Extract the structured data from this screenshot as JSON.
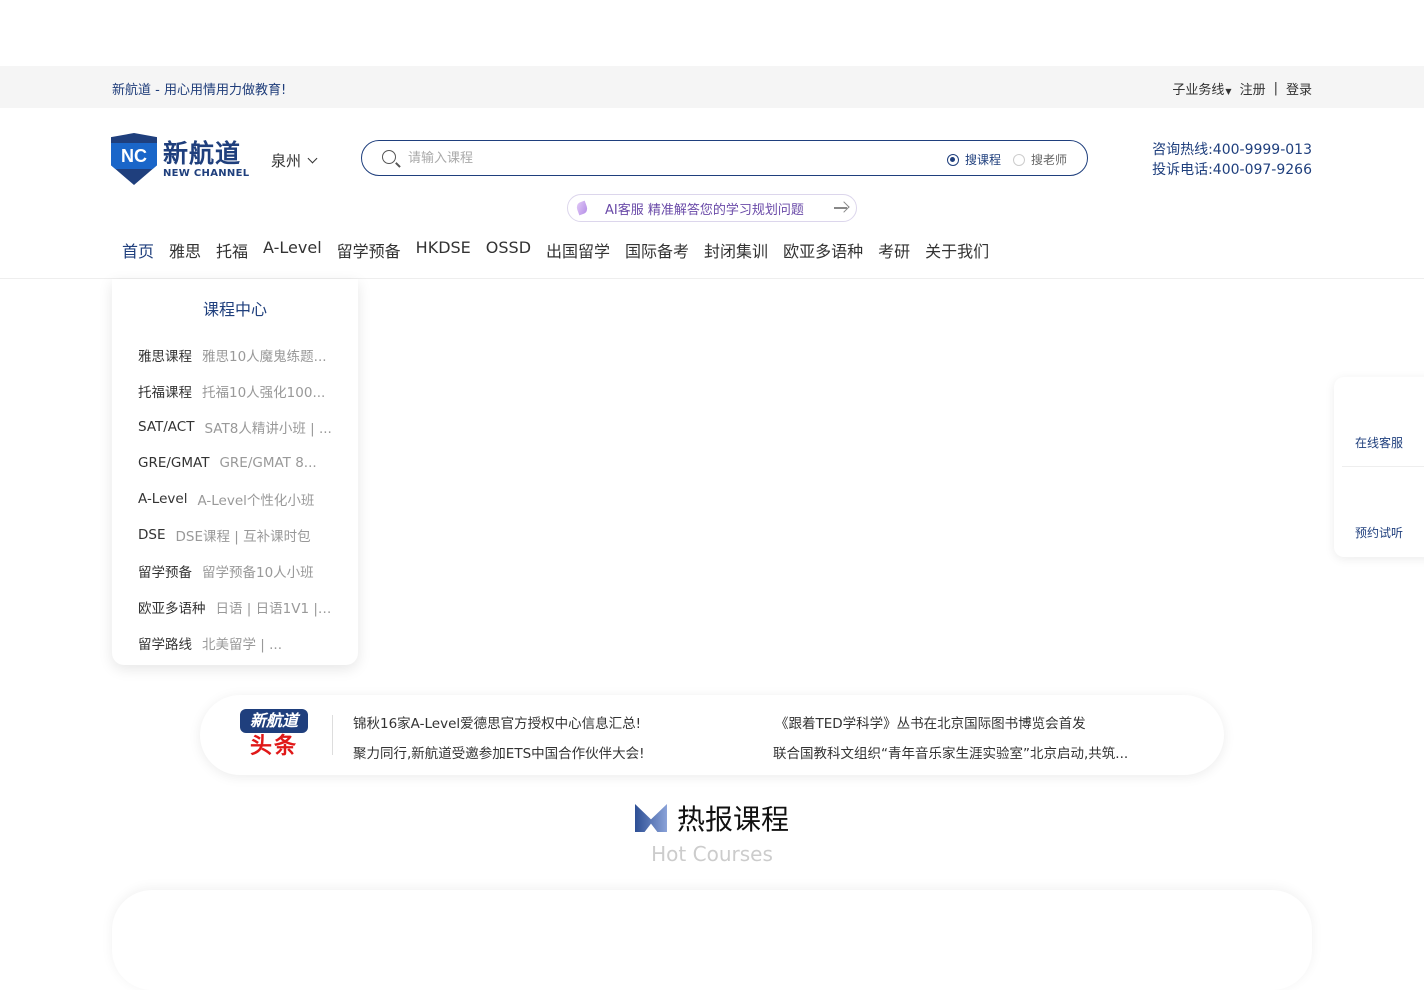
{
  "topbar": {
    "slogan": "新航道 - 用心用情用力做教育!",
    "business_line": "子业务线",
    "register": "注册",
    "separator": "|",
    "login": "登录"
  },
  "logo": {
    "mark": "NC",
    "cn": "新航道",
    "en": "NEW CHANNEL"
  },
  "city": {
    "name": "泉州"
  },
  "search": {
    "placeholder": "请输入课程",
    "options": [
      {
        "label": "搜课程",
        "selected": true
      },
      {
        "label": "搜老师",
        "selected": false
      }
    ]
  },
  "hotline": {
    "consult": "咨询热线:400-9999-013",
    "complaint": "投诉电话:400-097-9266"
  },
  "ai_banner": {
    "text": "AI客服 精准解答您的学习规划问题"
  },
  "nav": {
    "items": [
      "首页",
      "雅思",
      "托福",
      "A-Level",
      "留学预备",
      "HKDSE",
      "OSSD",
      "出国留学",
      "国际备考",
      "封闭集训",
      "欧亚多语种",
      "考研",
      "关于我们"
    ],
    "active_index": 0
  },
  "course_menu": {
    "title": "课程中心",
    "items": [
      {
        "name": "雅思课程",
        "desc": "雅思10人魔鬼练题..."
      },
      {
        "name": "托福课程",
        "desc": "托福10人强化100..."
      },
      {
        "name": "SAT/ACT",
        "desc": "SAT8人精讲小班 | ..."
      },
      {
        "name": "GRE/GMAT",
        "desc": "GRE/GMAT 8..."
      },
      {
        "name": "A-Level",
        "desc": "A-Level个性化小班"
      },
      {
        "name": "DSE",
        "desc": "DSE课程 | 互补课时包"
      },
      {
        "name": "留学预备",
        "desc": "留学预备10人小班"
      },
      {
        "name": "欧亚多语种",
        "desc": "日语 | 日语1V1 | ..."
      },
      {
        "name": "留学路线",
        "desc": "北美留学 | ..."
      }
    ]
  },
  "side_float": {
    "online_service": "在线客服",
    "book_trial": "预约试听"
  },
  "news": {
    "brand_top": "新航道",
    "brand_bottom": "头条",
    "items": [
      "锦秋16家A-Level爱德思官方授权中心信息汇总!",
      "聚力同行,新航道受邀参加ETS中国合作伙伴大会!",
      "《跟着TED学科学》丛书在北京国际图书博览会首发",
      "联合国教科文组织“青年音乐家生涯实验室”北京启动,共筑..."
    ]
  },
  "section": {
    "title": "热报课程",
    "subtitle": "Hot Courses"
  },
  "colors": {
    "brand_navy": "#1f3f7d",
    "brand_blue": "#1a66c9",
    "ai_purple": "#6a4aa8",
    "headline_red": "#e01818"
  }
}
